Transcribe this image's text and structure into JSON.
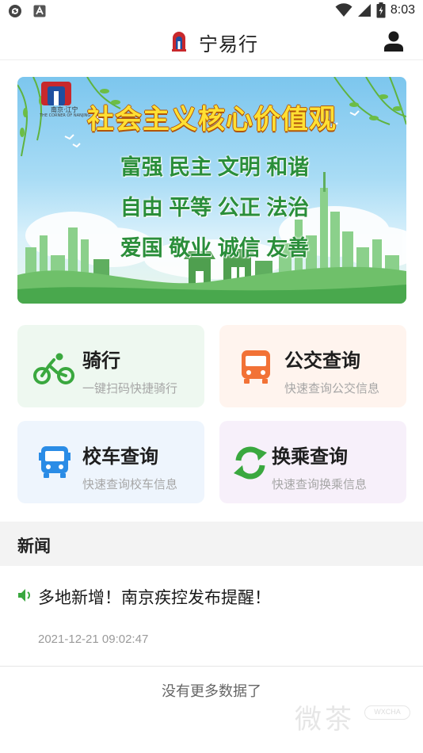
{
  "status_bar": {
    "time": "8:03",
    "left_icons": [
      "settings-sync-icon",
      "app-notification-icon"
    ],
    "right_icons": [
      "wifi-icon",
      "cell-signal-icon",
      "battery-charging-icon"
    ]
  },
  "header": {
    "title": "宁易行",
    "logo_icon": "nanjing-logo-icon",
    "user_icon": "user-profile-icon"
  },
  "banner": {
    "headline": "社会主义核心价值观",
    "values": [
      "富强",
      "民主",
      "文明",
      "和谐",
      "自由",
      "平等",
      "公正",
      "法治",
      "爱国",
      "敬业",
      "诚信",
      "友善"
    ],
    "logo_caption": "南京·江宁",
    "logo_subcaption": "THE CORNER OF NANJING"
  },
  "services": [
    {
      "title": "骑行",
      "subtitle": "一键扫码快捷骑行",
      "icon": "bicycle-icon",
      "bg": "#eef8f0",
      "color": "#3aa83f"
    },
    {
      "title": "公交查询",
      "subtitle": "快速查询公交信息",
      "icon": "bus-icon",
      "bg": "#fff4ee",
      "color": "#f27236"
    },
    {
      "title": "校车查询",
      "subtitle": "快速查询校车信息",
      "icon": "school-bus-icon",
      "bg": "#eef5fd",
      "color": "#2a8ce6"
    },
    {
      "title": "换乘查询",
      "subtitle": "快速查询换乘信息",
      "icon": "transfer-icon",
      "bg": "#f7f0fa",
      "color": "#3aa83f"
    }
  ],
  "news": {
    "section_title": "新闻",
    "items": [
      {
        "title": "多地新增！南京疾控发布提醒！",
        "date": "2021-12-21 09:02:47",
        "icon": "speaker-icon"
      }
    ],
    "end_text": "没有更多数据了"
  },
  "watermark": {
    "text": "微茶",
    "badge": "WXCHA"
  },
  "colors": {
    "accent_green": "#3aa83f",
    "accent_orange": "#f27236",
    "accent_blue": "#2a8ce6"
  }
}
